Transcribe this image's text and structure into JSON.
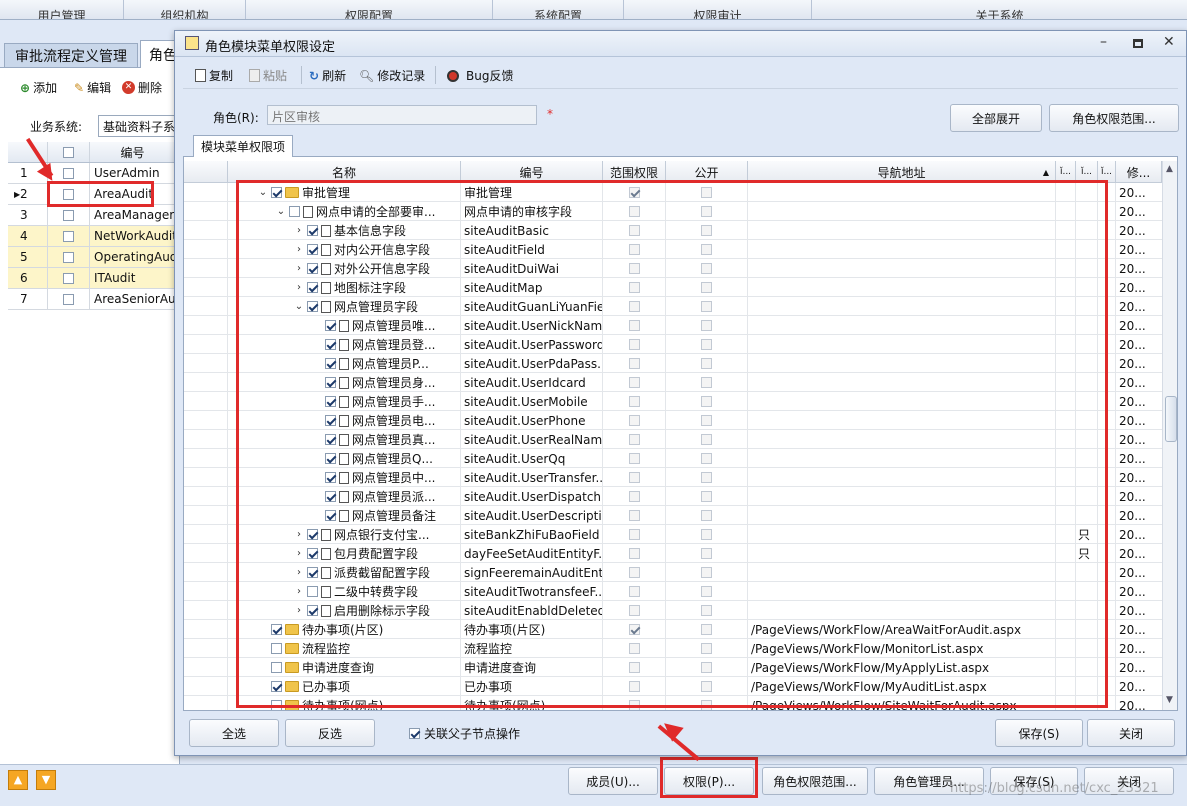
{
  "top_tabs": [
    "用户管理",
    "组织机构",
    "权限配置",
    "系统配置",
    "权限审计",
    "关于系统"
  ],
  "background": {
    "tab_left": "审批流程定义管理",
    "tab_right": "角色",
    "toolbar": {
      "add": "添加",
      "edit": "编辑",
      "delete": "删除"
    },
    "business_label": "业务系统:",
    "business_value": "基础资料子系",
    "col_code": "编号",
    "rows": [
      {
        "num": "1",
        "code": "UserAdmin"
      },
      {
        "num": "2",
        "code": "AreaAudit"
      },
      {
        "num": "3",
        "code": "AreaManagerA"
      },
      {
        "num": "4",
        "code": "NetWorkAudit"
      },
      {
        "num": "5",
        "code": "OperatingAudit"
      },
      {
        "num": "6",
        "code": "ITAudit"
      },
      {
        "num": "7",
        "code": "AreaSeniorAud"
      }
    ],
    "bottom_buttons": {
      "members": "成员(U)...",
      "permission": "权限(P)...",
      "role_scope": "角色权限范围...",
      "role_admin": "角色管理员...",
      "save": "保存(S)",
      "close": "关闭"
    },
    "watermark": "https://blog.csdn.net/cxc_23321"
  },
  "dialog": {
    "title": "角色模块菜单权限设定",
    "toolbar": {
      "copy": "复制",
      "paste": "粘贴",
      "refresh": "刷新",
      "log": "修改记录",
      "bug": "Bug反馈"
    },
    "role_label": "角色(R):",
    "role_value": "片区审核",
    "required_mark": "*",
    "expand_all": "全部展开",
    "role_scope": "角色权限范围...",
    "tab": "模块菜单权限项",
    "columns": {
      "name": "名称",
      "code": "编号",
      "scope": "范围权限",
      "public": "公开",
      "nav": "导航地址",
      "c6": "ǐ...",
      "c7": "ǐ...",
      "c8": "ǐ...",
      "c9": "修..."
    },
    "rows": [
      {
        "level": 0,
        "expander": "⌄",
        "checked": true,
        "icon": "folder",
        "name": "审批管理",
        "code": "审批管理",
        "scope": true,
        "pub": false,
        "nav": "",
        "x7": "",
        "mod": "20..."
      },
      {
        "level": 1,
        "expander": "⌄",
        "checked": false,
        "icon": "doc",
        "name": "网点申请的全部要审...",
        "code": "网点申请的审核字段",
        "scope": false,
        "pub": false,
        "nav": "",
        "x7": "",
        "mod": "20..."
      },
      {
        "level": 2,
        "expander": "›",
        "checked": true,
        "icon": "doc",
        "name": "基本信息字段",
        "code": "siteAuditBasic",
        "scope": false,
        "pub": false,
        "nav": "",
        "x7": "",
        "mod": "20..."
      },
      {
        "level": 2,
        "expander": "›",
        "checked": true,
        "icon": "doc",
        "name": "对内公开信息字段",
        "code": "siteAuditField",
        "scope": false,
        "pub": false,
        "nav": "",
        "x7": "",
        "mod": "20..."
      },
      {
        "level": 2,
        "expander": "›",
        "checked": true,
        "icon": "doc",
        "name": "对外公开信息字段",
        "code": "siteAuditDuiWai",
        "scope": false,
        "pub": false,
        "nav": "",
        "x7": "",
        "mod": "20..."
      },
      {
        "level": 2,
        "expander": "›",
        "checked": true,
        "icon": "doc",
        "name": "地图标注字段",
        "code": "siteAuditMap",
        "scope": false,
        "pub": false,
        "nav": "",
        "x7": "",
        "mod": "20..."
      },
      {
        "level": 2,
        "expander": "⌄",
        "checked": true,
        "icon": "doc",
        "name": "网点管理员字段",
        "code": "siteAuditGuanLiYuanField",
        "scope": false,
        "pub": false,
        "nav": "",
        "x7": "",
        "mod": "20..."
      },
      {
        "level": 3,
        "expander": "",
        "checked": true,
        "icon": "doc",
        "name": "网点管理员唯...",
        "code": "siteAudit.UserNickName",
        "scope": false,
        "pub": false,
        "nav": "",
        "x7": "",
        "mod": "20..."
      },
      {
        "level": 3,
        "expander": "",
        "checked": true,
        "icon": "doc",
        "name": "网点管理员登...",
        "code": "siteAudit.UserPassword",
        "scope": false,
        "pub": false,
        "nav": "",
        "x7": "",
        "mod": "20..."
      },
      {
        "level": 3,
        "expander": "",
        "checked": true,
        "icon": "doc",
        "name": "网点管理员P...",
        "code": "siteAudit.UserPdaPass...",
        "scope": false,
        "pub": false,
        "nav": "",
        "x7": "",
        "mod": "20..."
      },
      {
        "level": 3,
        "expander": "",
        "checked": true,
        "icon": "doc",
        "name": "网点管理员身...",
        "code": "siteAudit.UserIdcard",
        "scope": false,
        "pub": false,
        "nav": "",
        "x7": "",
        "mod": "20..."
      },
      {
        "level": 3,
        "expander": "",
        "checked": true,
        "icon": "doc",
        "name": "网点管理员手...",
        "code": "siteAudit.UserMobile",
        "scope": false,
        "pub": false,
        "nav": "",
        "x7": "",
        "mod": "20..."
      },
      {
        "level": 3,
        "expander": "",
        "checked": true,
        "icon": "doc",
        "name": "网点管理员电...",
        "code": "siteAudit.UserPhone",
        "scope": false,
        "pub": false,
        "nav": "",
        "x7": "",
        "mod": "20..."
      },
      {
        "level": 3,
        "expander": "",
        "checked": true,
        "icon": "doc",
        "name": "网点管理员真...",
        "code": "siteAudit.UserRealName",
        "scope": false,
        "pub": false,
        "nav": "",
        "x7": "",
        "mod": "20..."
      },
      {
        "level": 3,
        "expander": "",
        "checked": true,
        "icon": "doc",
        "name": "网点管理员Q...",
        "code": "siteAudit.UserQq",
        "scope": false,
        "pub": false,
        "nav": "",
        "x7": "",
        "mod": "20..."
      },
      {
        "level": 3,
        "expander": "",
        "checked": true,
        "icon": "doc",
        "name": "网点管理员中...",
        "code": "siteAudit.UserTransfer...",
        "scope": false,
        "pub": false,
        "nav": "",
        "x7": "",
        "mod": "20..."
      },
      {
        "level": 3,
        "expander": "",
        "checked": true,
        "icon": "doc",
        "name": "网点管理员派...",
        "code": "siteAudit.UserDispatch...",
        "scope": false,
        "pub": false,
        "nav": "",
        "x7": "",
        "mod": "20..."
      },
      {
        "level": 3,
        "expander": "",
        "checked": true,
        "icon": "doc",
        "name": "网点管理员备注",
        "code": "siteAudit.UserDescription",
        "scope": false,
        "pub": false,
        "nav": "",
        "x7": "",
        "mod": "20..."
      },
      {
        "level": 2,
        "expander": "›",
        "checked": true,
        "icon": "doc",
        "name": "网点银行支付宝...",
        "code": "siteBankZhiFuBaoField",
        "scope": false,
        "pub": false,
        "nav": "",
        "x7": "只",
        "mod": "20..."
      },
      {
        "level": 2,
        "expander": "›",
        "checked": true,
        "icon": "doc",
        "name": "包月费配置字段",
        "code": "dayFeeSetAuditEntityF...",
        "scope": false,
        "pub": false,
        "nav": "",
        "x7": "只",
        "mod": "20..."
      },
      {
        "level": 2,
        "expander": "›",
        "checked": true,
        "icon": "doc",
        "name": "派费截留配置字段",
        "code": "signFeeremainAuditEnt...",
        "scope": false,
        "pub": false,
        "nav": "",
        "x7": "",
        "mod": "20..."
      },
      {
        "level": 2,
        "expander": "›",
        "checked": false,
        "icon": "doc",
        "name": "二级中转费字段",
        "code": "siteAuditTwotransfeeF...",
        "scope": false,
        "pub": false,
        "nav": "",
        "x7": "",
        "mod": "20..."
      },
      {
        "level": 2,
        "expander": "›",
        "checked": true,
        "icon": "doc",
        "name": "启用删除标示字段",
        "code": "siteAuditEnabldDeleted",
        "scope": false,
        "pub": false,
        "nav": "",
        "x7": "",
        "mod": "20..."
      },
      {
        "level": 0,
        "expander": "",
        "checked": true,
        "icon": "folder",
        "name": "待办事项(片区)",
        "code": "待办事项(片区)",
        "scope": true,
        "pub": false,
        "nav": "/PageViews/WorkFlow/AreaWaitForAudit.aspx",
        "x7": "",
        "mod": "20..."
      },
      {
        "level": 0,
        "expander": "",
        "checked": false,
        "icon": "folder",
        "name": "流程监控",
        "code": "流程监控",
        "scope": false,
        "pub": false,
        "nav": "/PageViews/WorkFlow/MonitorList.aspx",
        "x7": "",
        "mod": "20..."
      },
      {
        "level": 0,
        "expander": "",
        "checked": false,
        "icon": "folder",
        "name": "申请进度查询",
        "code": "申请进度查询",
        "scope": false,
        "pub": false,
        "nav": "/PageViews/WorkFlow/MyApplyList.aspx",
        "x7": "",
        "mod": "20..."
      },
      {
        "level": 0,
        "expander": "",
        "checked": true,
        "icon": "folder",
        "name": "已办事项",
        "code": "已办事项",
        "scope": false,
        "pub": false,
        "nav": "/PageViews/WorkFlow/MyAuditList.aspx",
        "x7": "",
        "mod": "20..."
      },
      {
        "level": 0,
        "expander": "",
        "checked": false,
        "icon": "folder",
        "name": "待办事项(网点)",
        "code": "待办事项(网点)",
        "scope": false,
        "pub": false,
        "nav": "/PageViews/WorkFlow/SiteWaitForAudit.aspx",
        "x7": "",
        "mod": "20..."
      }
    ],
    "select_all": "全选",
    "invert": "反选",
    "link_parent_label": "关联父子节点操作",
    "link_parent_checked": true,
    "save": "保存(S)",
    "close": "关闭"
  },
  "colors": {
    "highlight_red": "#e02a2a",
    "accent_blue": "#2b5797"
  }
}
